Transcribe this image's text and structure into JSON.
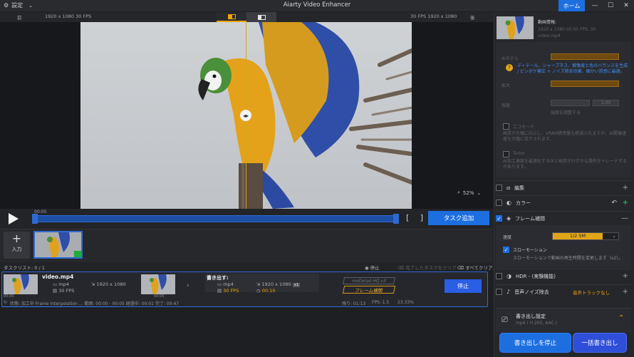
{
  "app": {
    "title": "Aiarty Video Enhancer",
    "settings_label": "設定",
    "home_label": "ホーム"
  },
  "preview": {
    "before_label": "前",
    "after_label": "後",
    "src_info": "1920 x 1080  30 FPS",
    "out_info": "30 FPS  1920 x 1080",
    "zoom": "52%"
  },
  "timeline": {
    "time_start": "00:00",
    "add_task_label": "タスク追加"
  },
  "input": {
    "input_label": "入力"
  },
  "tasklist": {
    "title": "タスクリスト: 0 / 1",
    "stop_label": "停止",
    "clear_done_label": "完了したタスクをクリア",
    "clear_all_label": "すべてクリア",
    "task": {
      "filename": "video.mp4",
      "src_format": "mp4",
      "src_fps": "30 FPS",
      "src_res": "1920 x 1080",
      "src_t1": "00:00",
      "src_t2": "00:05",
      "export_label": "書き出す:",
      "out_format": "mp4",
      "out_fps": "30 FPS",
      "out_res": "1920 x 1080",
      "out_scale": "x1",
      "out_time": "00:10",
      "model_tag": "moDetail-HQ  v3",
      "frame_tag": "フレーム補間",
      "stop_label": "停止",
      "status": "状態: 加工中 Frame Interpolation ...  範囲: 00:00 - 00:05    経過中: 00:01    完了: 00:47",
      "remaining": "残り: 01:13",
      "fps": "FPS: 1.5",
      "percent": "23.33%"
    }
  },
  "right_panel": {
    "video_info_title": "動画情報:",
    "video_info_line1": "1920 x 1080  00:05   FPS: 30",
    "video_info_line2": "video.mp4",
    "ai_model_label": "AIモデル",
    "ai_note": "ディテール、シャープネス、解像度と色のバランスを生成 / ピンボケ補正 + ノイズ除去効果、細かい質感に最適。",
    "scale_label": "拡大",
    "strength_label": "強度",
    "strength_value": "1.00",
    "strength_note": "強度を調整する",
    "cpu_mode_label": "エコモード",
    "cpu_mode_note": "画質が大幅に向上し、VRAM使用量も削減されますが、AI開催速度も大幅に低下されます。",
    "turbo_label": "Turbo",
    "turbo_note": "AI加工速度を最適化するほど画質がわずかな損失をトレードするがあります。",
    "sect_edit": "編集",
    "sect_color": "カラー",
    "sect_frame": "フレーム補間",
    "speed_label": "速度",
    "speed_value": "1/2 SM",
    "slowmo_label": "スローモーション",
    "slowmo_note": "スローモーションで動画の再生時間を変更します（x2）。",
    "sect_hdr": "HDR - (実験機能)",
    "sect_noise": "音声ノイズ除去",
    "noise_value": "音声トラックなし",
    "export_settings_title": "書き出し設定",
    "export_settings_sub": "mp4 ( H.265, AAC )",
    "stop_export_label": "書き出しを停止",
    "batch_export_label": "一括書き出し"
  }
}
